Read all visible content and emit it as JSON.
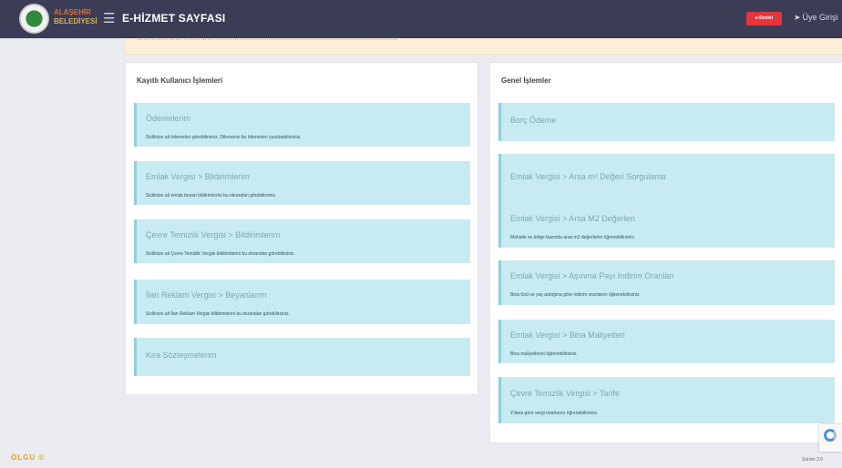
{
  "header": {
    "logo_line1": "ALAŞEHİR",
    "logo_line2": "BELEDİYESİ",
    "menu_icon": "hamburger-icon",
    "title": "E-HİZMET SAYFASI",
    "badge": "e-Devlet",
    "logout_label": "Üye Girişi",
    "logout_icon": "sign-in-icon"
  },
  "notice": {
    "text": "……………………………………………………………………………………………………………"
  },
  "left_panel": {
    "title": "Kayıtlı Kullanıcı İşlemleri",
    "cards": [
      {
        "title": "Ödemelerim",
        "desc": "Sicilinize ait ödemeleri görebilirsiniz. Dilerseniz bu ödemeleri yazdırabilirsiniz."
      },
      {
        "title": "Emlak Vergisi > Bildirimlerim",
        "desc": "Sicilinize ait emlak beyan bildirimlerini bu ekrandan görebilirsiniz."
      },
      {
        "title": "Çevre Temizlik Vergisi > Bildirimlerim",
        "desc": "Sicilinize ait Çevre Temizlik Vergisi bildirimlerini bu ekrandan görebilirsiniz."
      },
      {
        "title": "İlan Reklam Vergisi > Beyanlarım",
        "desc": "Sicilinize ait İlan Reklam Vergisi bildirimlerini bu ekrandan görebilirsiniz."
      },
      {
        "title": "Kira Sözleşmelerim",
        "desc": ""
      }
    ]
  },
  "right_panel": {
    "title": "Genel İşlemler",
    "cards": [
      {
        "title": "Borç Ödeme",
        "desc": ""
      },
      {
        "title": "Emlak Vergisi > Arsa m² Değeri Sorgulama",
        "desc": ""
      },
      {
        "title": "Emlak Vergisi > Arsa M2 Değerleri",
        "desc": "Mahalle ve bölge bazında arsa m2 değerlerini öğrenebilirsiniz."
      },
      {
        "title": "Emlak Vergisi > Aşınma Payı İndirim Oranları",
        "desc": "Bina türü ve yaş aralığına göre indirim oranlarını öğrenebilirsiniz."
      },
      {
        "title": "Emlak Vergisi > Bina Maliyetleri",
        "desc": "Bina maliyetlerini öğrenebilirsiniz."
      },
      {
        "title": "Çevre Temizlik Vergisi > Tarife",
        "desc": "Yıllara göre vergi tutarlarını öğrenebilirsiniz."
      }
    ]
  },
  "footer": {
    "logo": "OLGU ©",
    "right_text": "Sürüm 2.0"
  }
}
